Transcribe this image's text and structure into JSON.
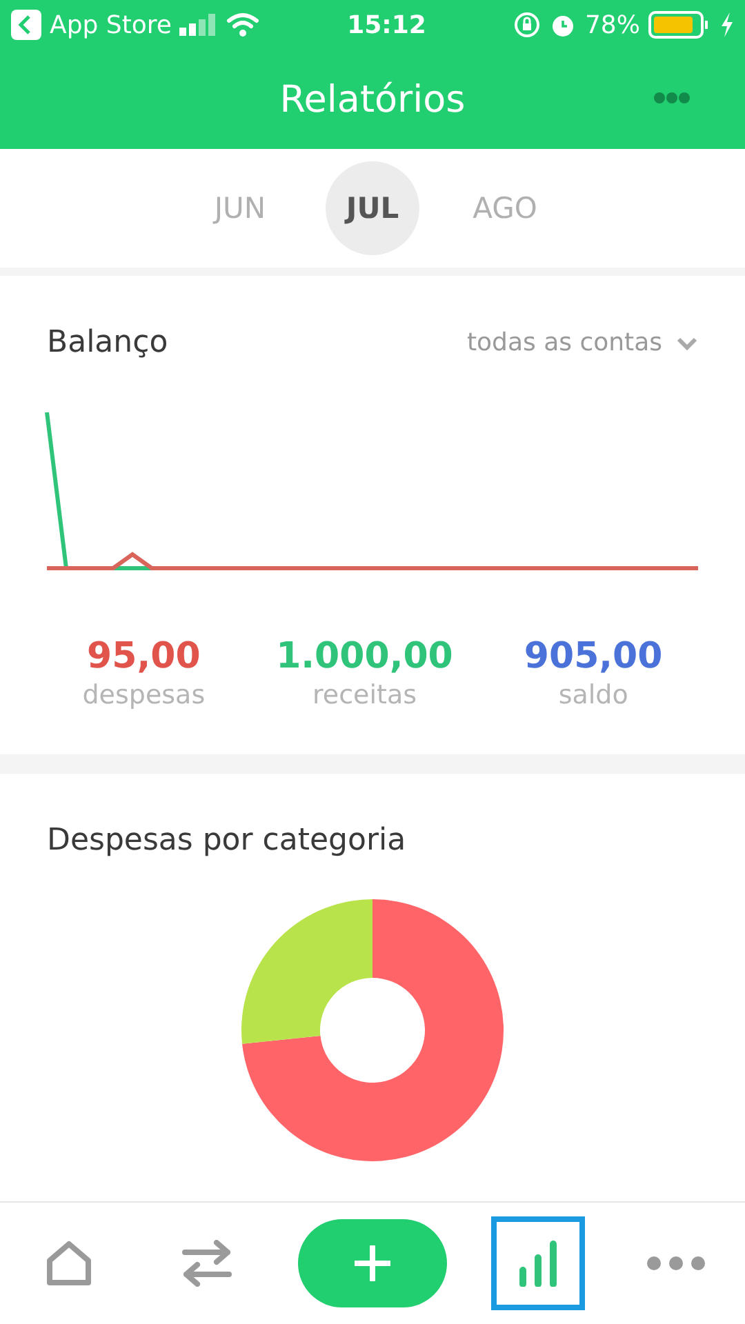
{
  "status_bar": {
    "back_label": "App Store",
    "time": "15:12",
    "battery": "78%"
  },
  "header": {
    "title": "Relatórios"
  },
  "months": [
    {
      "label": "JUN",
      "selected": false
    },
    {
      "label": "JUL",
      "selected": true
    },
    {
      "label": "AGO",
      "selected": false
    }
  ],
  "balance": {
    "title": "Balanço",
    "account_filter": "todas as contas",
    "summary": [
      {
        "value": "95,00",
        "label": "despesas",
        "color": "#e0544c"
      },
      {
        "value": "1.000,00",
        "label": "receitas",
        "color": "#2fc47a"
      },
      {
        "value": "905,00",
        "label": "saldo",
        "color": "#4b72d9"
      }
    ]
  },
  "categories": {
    "title": "Despesas por categoria"
  },
  "nav": [
    {
      "kind": "home",
      "selected": false
    },
    {
      "kind": "transfer",
      "selected": false
    },
    {
      "kind": "add",
      "selected": false
    },
    {
      "kind": "reports",
      "selected": true
    },
    {
      "kind": "more",
      "selected": false
    }
  ]
}
